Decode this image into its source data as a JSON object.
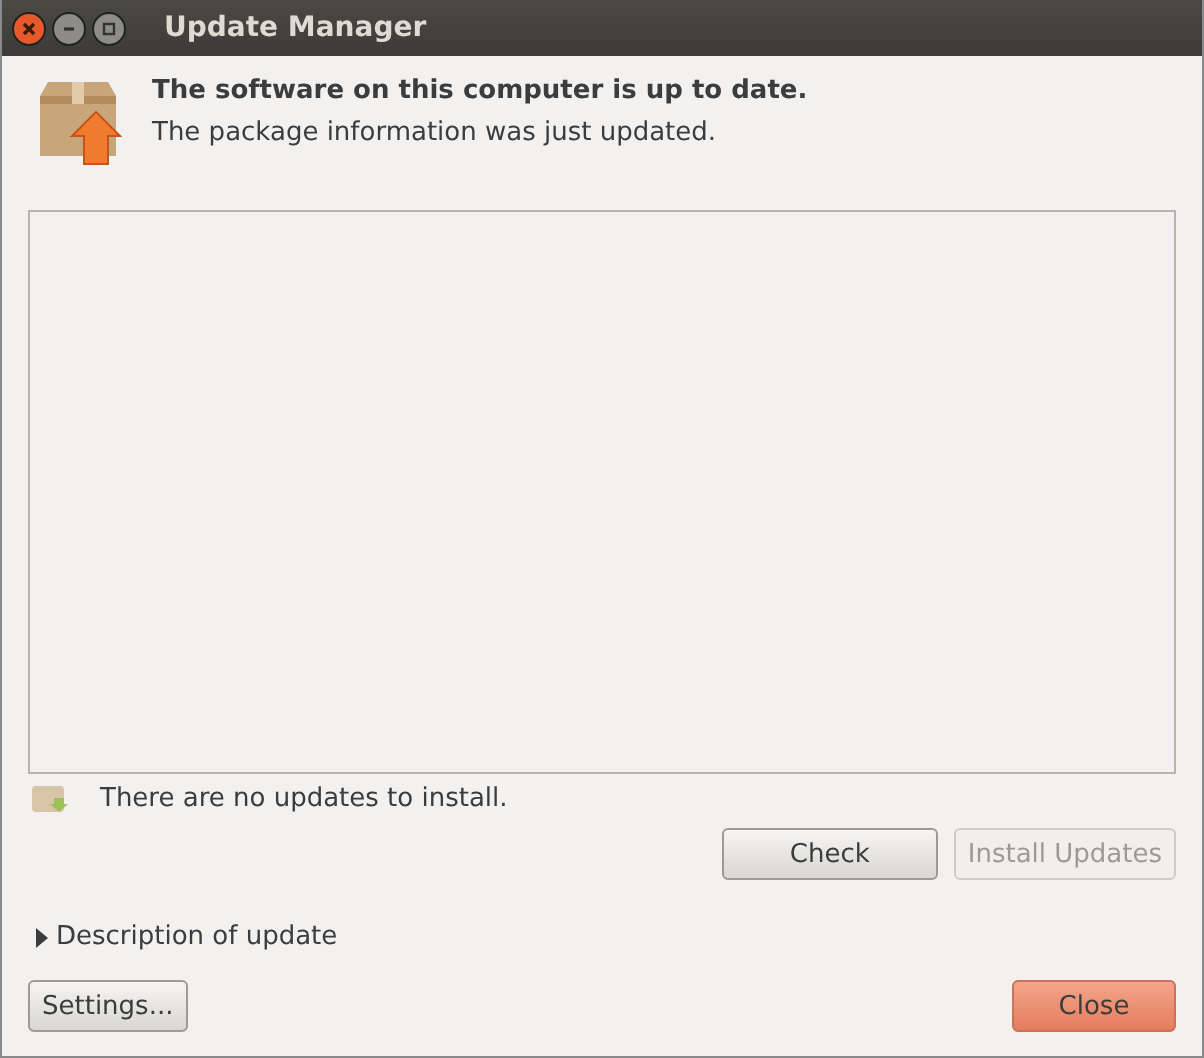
{
  "window": {
    "title": "Update Manager"
  },
  "header": {
    "title": "The software on this computer is up to date.",
    "subtitle": "The package information was just updated."
  },
  "status": {
    "text": "There are no updates to install."
  },
  "actions": [
    {
      "label": "Check",
      "disabled": false
    },
    {
      "label": "Install Updates",
      "disabled": true
    }
  ],
  "expander": {
    "label": "Description of update",
    "expanded": false
  },
  "footer": [
    {
      "label": "Settings...",
      "kind": "normal"
    },
    {
      "label": "Close",
      "kind": "default"
    }
  ]
}
